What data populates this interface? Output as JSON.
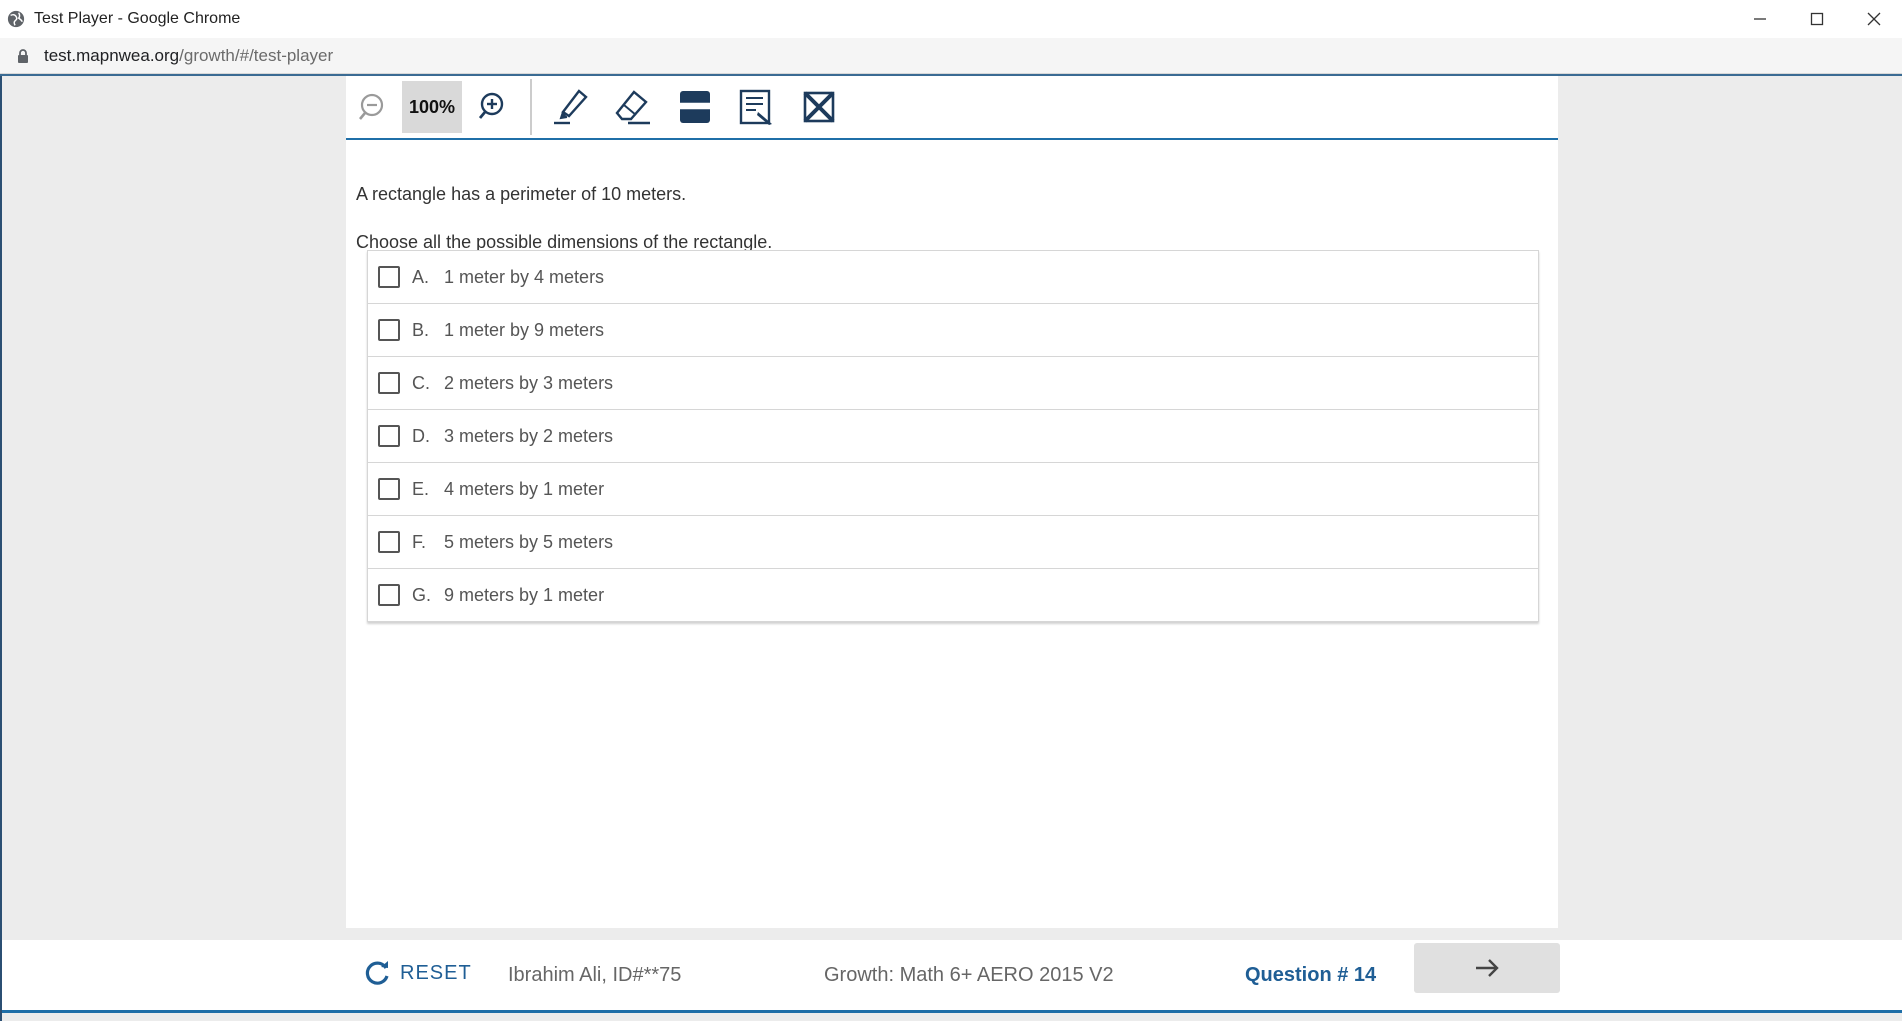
{
  "window": {
    "title": "Test Player - Google Chrome"
  },
  "address_bar": {
    "url_host": "test.mapnwea.org",
    "url_path": "/growth/#/test-player"
  },
  "toolbar": {
    "zoom_level": "100%"
  },
  "question": {
    "stem": "A rectangle has a perimeter of 10 meters.",
    "prompt_before": "Choose ",
    "prompt_emphasis": "all",
    "prompt_after": " the possible dimensions of the rectangle.",
    "choices": [
      {
        "letter": "A.",
        "text": "1 meter by 4 meters"
      },
      {
        "letter": "B.",
        "text": "1 meter by 9 meters"
      },
      {
        "letter": "C.",
        "text": "2 meters by 3 meters"
      },
      {
        "letter": "D.",
        "text": "3 meters by 2 meters"
      },
      {
        "letter": "E.",
        "text": "4 meters by 1 meter"
      },
      {
        "letter": "F.",
        "text": "5 meters by 5 meters"
      },
      {
        "letter": "G.",
        "text": "9 meters by 1 meter"
      }
    ]
  },
  "footer": {
    "reset_label": "RESET",
    "student": "Ibrahim Ali, ID#**75",
    "test_name": "Growth: Math 6+ AERO 2015 V2",
    "question_number": "Question # 14"
  },
  "colors": {
    "accent": "#1f5e95",
    "toolbar_border": "#1f6fa8"
  }
}
